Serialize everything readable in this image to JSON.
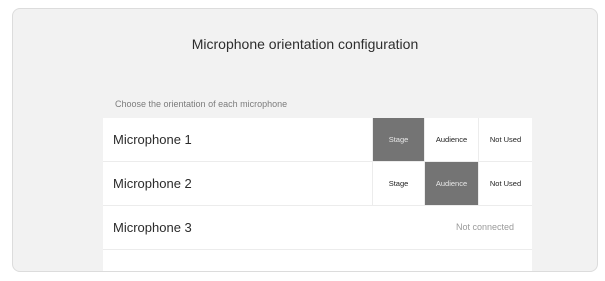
{
  "panel": {
    "title": "Microphone orientation configuration",
    "subtitle": "Choose the orientation of each microphone"
  },
  "microphones": [
    {
      "name": "Microphone 1",
      "options": [
        "Stage",
        "Audience",
        "Not Used"
      ],
      "selected": "Stage"
    },
    {
      "name": "Microphone 2",
      "options": [
        "Stage",
        "Audience",
        "Not Used"
      ],
      "selected": "Audience"
    },
    {
      "name": "Microphone 3",
      "status": "Not connected"
    }
  ],
  "colors": {
    "selected_segment": "#747474",
    "background": "#f2f2f2"
  }
}
